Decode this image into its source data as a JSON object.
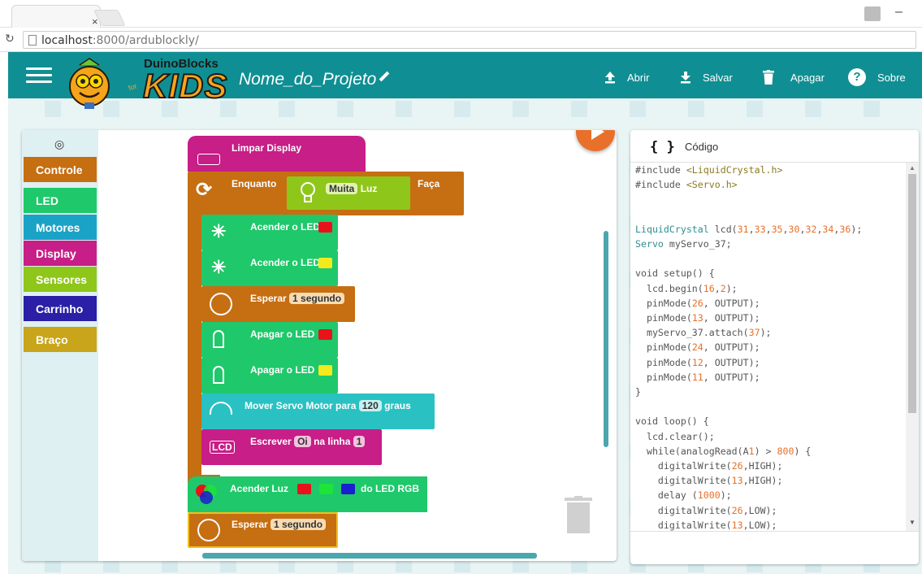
{
  "browser": {
    "tab_close": "×",
    "url_host": "localhost",
    "url_rest": ":8000/ardublockly/"
  },
  "header": {
    "logo_text_top": "DuinoBlocks",
    "logo_for": "for",
    "logo_text_bottom": "KIDS",
    "project_name": "Nome_do_Projeto",
    "actions": [
      {
        "icon": "upload-icon",
        "label": "Abrir"
      },
      {
        "icon": "download-icon",
        "label": "Salvar"
      },
      {
        "icon": "trash-icon",
        "label": "Apagar"
      },
      {
        "icon": "help-icon",
        "label": "Sobre"
      }
    ]
  },
  "toolbox": {
    "categories": [
      {
        "label": "Controle",
        "color": "#c66e12"
      },
      {
        "label": "LED",
        "color": "#1fc86a"
      },
      {
        "label": "Motores",
        "color": "#1aa3c7"
      },
      {
        "label": "Display",
        "color": "#c71e87"
      },
      {
        "label": "Sensores",
        "color": "#8fc61a"
      },
      {
        "label": "Carrinho",
        "color": "#2a1fa6"
      },
      {
        "label": "Braço",
        "color": "#c8a51a"
      }
    ]
  },
  "blocks": {
    "limpar": "Limpar Display",
    "enquanto": "Enquanto",
    "muita": "Muita",
    "luz": "Luz",
    "faca": "Faça",
    "acender1": "Acender o LED",
    "acender2": "Acender o LED",
    "esperar1": "Esperar",
    "segundo1": "1 segundo",
    "apagar1": "Apagar o LED",
    "apagar2": "Apagar o LED",
    "servo": "Mover Servo Motor para",
    "servo_val": "120",
    "graus": "graus",
    "escrever": "Escrever",
    "oi": "Oi",
    "na_linha": "na  linha",
    "linha_val": "1",
    "lcd": "LCD",
    "acender_luz": "Acender Luz",
    "do_led_rgb": "do LED RGB",
    "esperar2": "Esperar",
    "segundo2": "1 segundo"
  },
  "colors": {
    "control": "#c66e12",
    "led": "#1fc86a",
    "motor": "#1aa3c7",
    "motor_block": "#2ac1c3",
    "display": "#c71e87",
    "sensor": "#8fc61a",
    "red": "#e8121b",
    "yellow": "#f2ea1c",
    "green": "#1ee33a",
    "blue": "#1a1fcf",
    "teal": "#0f8f93",
    "accent": "#e8702a"
  },
  "code_panel": {
    "title": "Código",
    "lines": [
      "#include <LiquidCrystal.h>",
      "#include <Servo.h>",
      "",
      "",
      "LiquidCrystal lcd(31,33,35,30,32,34,36);",
      "Servo myServo_37;",
      "",
      "void setup() {",
      "  lcd.begin(16,2);",
      "  pinMode(26, OUTPUT);",
      "  pinMode(13, OUTPUT);",
      "  myServo_37.attach(37);",
      "  pinMode(24, OUTPUT);",
      "  pinMode(12, OUTPUT);",
      "  pinMode(11, OUTPUT);",
      "}",
      "",
      "void loop() {",
      "  lcd.clear();",
      "  while(analogRead(A1) > 800) {",
      "    digitalWrite(26,HIGH);",
      "    digitalWrite(13,HIGH);",
      "    delay (1000);",
      "    digitalWrite(26,LOW);",
      "    digitalWrite(13,LOW);"
    ]
  }
}
